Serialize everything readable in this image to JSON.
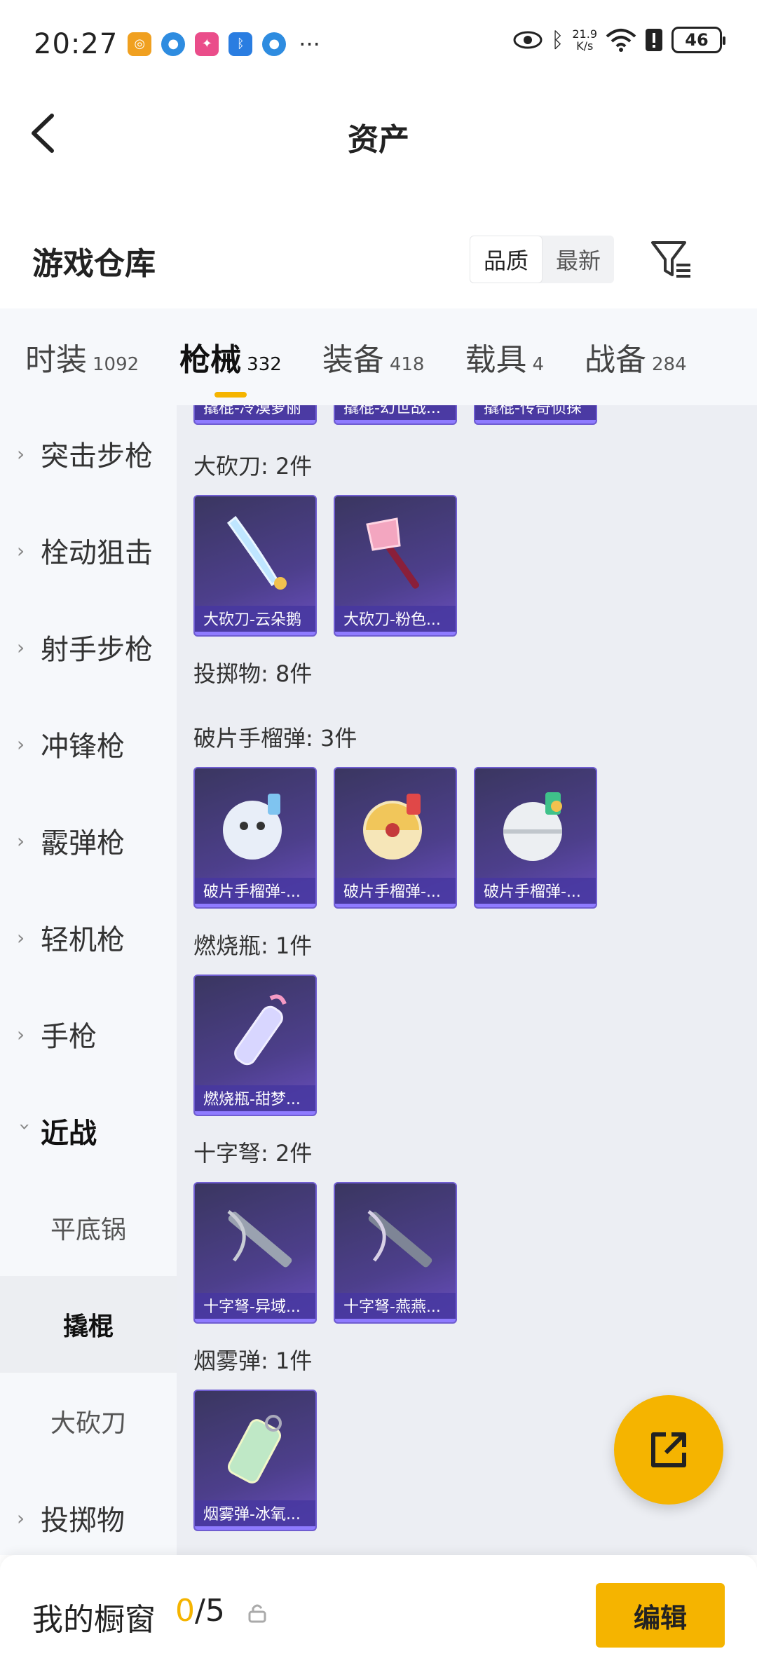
{
  "status_bar": {
    "time": "20:27",
    "net_speed_value": "21.9",
    "net_speed_unit": "K/s",
    "battery": "46",
    "more": "···"
  },
  "header": {
    "title": "资产"
  },
  "warehouse": {
    "title": "游戏仓库",
    "sort_options": [
      "品质",
      "最新"
    ],
    "active_sort": "品质"
  },
  "tabs": [
    {
      "label": "时装",
      "count": "1092"
    },
    {
      "label": "枪械",
      "count": "332",
      "active": true
    },
    {
      "label": "装备",
      "count": "418"
    },
    {
      "label": "载具",
      "count": "4"
    },
    {
      "label": "战备",
      "count": "284"
    }
  ],
  "sidebar": {
    "items": [
      {
        "label": "突击步枪"
      },
      {
        "label": "栓动狙击"
      },
      {
        "label": "射手步枪"
      },
      {
        "label": "冲锋枪"
      },
      {
        "label": "霰弹枪"
      },
      {
        "label": "轻机枪"
      },
      {
        "label": "手枪"
      },
      {
        "label": "近战",
        "open": true
      }
    ],
    "subitems": [
      {
        "label": "平底锅"
      },
      {
        "label": "撬棍",
        "selected": true
      },
      {
        "label": "大砍刀"
      }
    ],
    "after": [
      {
        "label": "投掷物"
      }
    ]
  },
  "content": {
    "top_partial_cards": [
      "撬棍-冷漠萝丽",
      "撬棍-幻世战...",
      "撬棍-传奇侦探"
    ],
    "sections": [
      {
        "title": "大砍刀: 2件",
        "cards": [
          "大砍刀-云朵鹅",
          "大砍刀-粉色..."
        ]
      },
      {
        "title": "投掷物: 8件",
        "cards": []
      },
      {
        "title": "破片手榴弹: 3件",
        "cards": [
          "破片手榴弹-...",
          "破片手榴弹-...",
          "破片手榴弹-..."
        ]
      },
      {
        "title": "燃烧瓶: 1件",
        "cards": [
          "燃烧瓶-甜梦..."
        ]
      },
      {
        "title": "十字弩: 2件",
        "cards": [
          "十字弩-异域...",
          "十字弩-燕燕..."
        ]
      },
      {
        "title": "烟雾弹: 1件",
        "cards": [
          "烟雾弹-冰氧..."
        ]
      }
    ]
  },
  "bottom_bar": {
    "label": "我的橱窗",
    "count_current": "0",
    "count_total": "/5",
    "edit_label": "编辑"
  },
  "colors": {
    "accent": "#f5b400",
    "card_bg": "#4d3f8c",
    "card_border": "#6f5dd0"
  }
}
